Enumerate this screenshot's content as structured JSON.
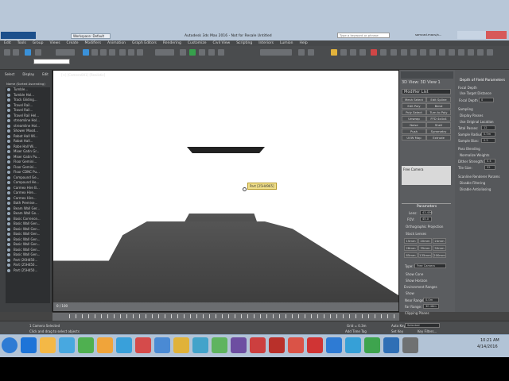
{
  "app": {
    "title": "Autodesk 3ds Max 2016 - Not for Resale   Untitled",
    "workspace_tab": "Workspace: Default",
    "search_placeholder": "Type a keyword or phrase",
    "user_label": "samcad.macs/a..."
  },
  "menus": [
    "Edit",
    "Tools",
    "Group",
    "Views",
    "Create",
    "Modifiers",
    "Animation",
    "Graph Editors",
    "Rendering",
    "Customize",
    "Civil View",
    "Scripting",
    "Interiors",
    "Lumion",
    "Help"
  ],
  "left": {
    "tabs": [
      "Select",
      "Display",
      "Edit"
    ],
    "header": "Name (Sorted Ascending)",
    "items": [
      "Tumble...",
      "Tumble Hol...",
      "Track Gliding...",
      "Travel Rail...",
      "Travel Rail...",
      "Travel Rail Hel...",
      "streamline Hol...",
      "streamline Hol...",
      "Shower Mood...",
      "Robot Hall Wi...",
      "Robot Hall...",
      "Robe Hall Wi...",
      "Mixer Gatin Gr...",
      "Mixer Gatin Pu...",
      "Floor Gemini...",
      "Floor Gemini...",
      "Floor CDNC Pu...",
      "Compound Ge...",
      "Compound He...",
      "Carmex Hire B...",
      "Carmex Hire...",
      "Carmex Hire...",
      "Bath Premise...",
      "Beam Wall Ger...",
      "Beam Wall Ge...",
      "Basic Corrence...",
      "Basic Wall Gen...",
      "Basic Wall Gen...",
      "Basic Wall Gen...",
      "Basic Wall Gen...",
      "Basic Wall Gen...",
      "Basic Wall Gen...",
      "Basic Wall Gen...",
      "Part (26H450...",
      "Part (25H450...",
      "Part (25H450..."
    ]
  },
  "viewport": {
    "label": "[+] [Camera001] [Realistic]",
    "tooltip": "Part [25H4965]",
    "time": "0 / 100"
  },
  "right": {
    "object_name": "3D View: 3D View 1",
    "modifier_list": "Modifier List",
    "buttons": [
      "Mesh Select",
      "Edit Spline",
      "Edit Poly",
      "Bend",
      "Poly Select",
      "Turn to Poly",
      "Unwrap",
      "FFD 4x4x4",
      "Noise",
      "Shell",
      "Push",
      "Symmetry",
      "UVW Map",
      "Extrude",
      "Lathe",
      "Displace"
    ],
    "free_camera_label": "Free Camera",
    "parameters_title": "Parameters",
    "lens_label": "Lens:",
    "lens_value": "43.456",
    "fov_label": "FOV:",
    "fov_value": "45.0",
    "ortho_label": "Orthographic Projection",
    "stock_lenses_title": "Stock Lenses",
    "stock_lenses": [
      "15mm",
      "20mm",
      "24mm",
      "28mm",
      "35mm",
      "50mm",
      "85mm",
      "135mm",
      "200mm"
    ],
    "type_label": "Type:",
    "type_value": "Free Camera",
    "show_cone": "Show Cone",
    "show_horizon": "Show Horizon",
    "env_ranges": "Environment Ranges",
    "show": "Show",
    "near_label": "Near Range:",
    "near_value": "0.0m",
    "far_label": "Far Range:",
    "far_value": "30.48m",
    "clipping": "Clipping Planes",
    "dof_title": "Depth of Field Parameters",
    "focal_depth": "Focal Depth",
    "use_target_distance": "Use Target Distance",
    "focal_depth_value": "0",
    "sampling": "Sampling",
    "display_passes": "Display Passes",
    "use_original_location": "Use Original Location",
    "total_passes_label": "Total Passes:",
    "total_passes_value": "12",
    "sample_radius_label": "Sample Radius:",
    "sample_radius_value": "0.5m",
    "sample_bias_label": "Sample Bias:",
    "sample_bias_value": "0.5",
    "pass_blending": "Pass Blending",
    "normalize_weights": "Normalize Weights",
    "dither_strength": "Dither Strength:",
    "dither_value": "0.4",
    "tile_size": "Tile Size:",
    "tile_value": "32",
    "scanline_params": "Scanline Renderer Params",
    "disable_filtering": "Disable Filtering",
    "disable_antialiasing": "Disable Antialiasing"
  },
  "status": {
    "selection": "1 Camera Selected",
    "prompt": "Click and drag to select objects",
    "grid": "Grid = 0.3m",
    "autokey": "Auto Key",
    "selected": "Selected",
    "set_key": "Set Key",
    "key_filters": "Key Filters...",
    "add_time_tag": "Add Time Tag"
  },
  "taskbar": {
    "time": "10:21 AM",
    "date": "4/14/2016"
  }
}
